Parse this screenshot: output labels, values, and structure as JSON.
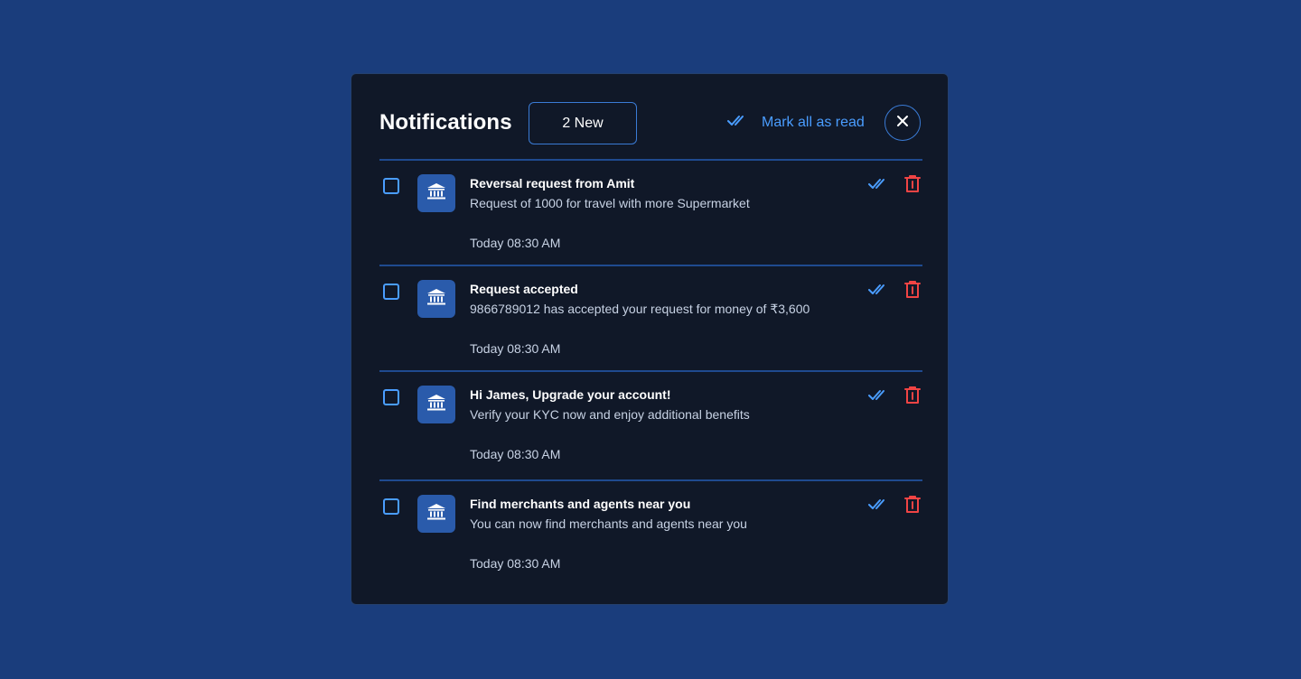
{
  "header": {
    "title": "Notifications",
    "new_badge": "2 New",
    "mark_all_label": "Mark all as read"
  },
  "notifications": [
    {
      "title": "Reversal request from Amit",
      "body": "Request of 1000 for travel with more Supermarket",
      "time": "Today 08:30 AM"
    },
    {
      "title": "Request accepted",
      "body": "9866789012 has accepted your request for money of ₹3,600",
      "time": "Today 08:30 AM"
    },
    {
      "title": "Hi James, Upgrade your account!",
      "body": "Verify your KYC now and enjoy additional benefits",
      "time": "Today 08:30 AM"
    },
    {
      "title": "Find merchants and agents near you",
      "body": "You can now find merchants and agents near you",
      "time": "Today 08:30 AM"
    }
  ],
  "colors": {
    "background": "#1a3d7c",
    "panel": "#101828",
    "accent": "#4a9dff",
    "danger": "#f04444",
    "icon_tile": "#2a5bab"
  },
  "icons": {
    "mark_all": "double-check-icon",
    "close": "close-icon",
    "item_icon": "bank-icon",
    "read": "double-check-icon",
    "delete": "trash-icon"
  }
}
